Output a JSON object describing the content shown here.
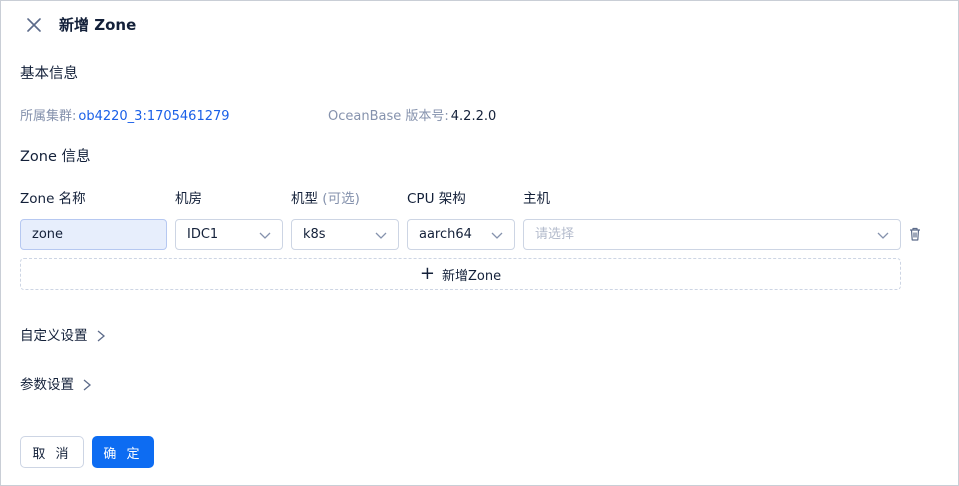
{
  "header": {
    "title": "新增 Zone",
    "close_icon": "close-icon"
  },
  "basic_info": {
    "heading": "基本信息",
    "cluster_label": "所属集群:",
    "cluster_value": "ob4220_3:1705461279",
    "version_label": "OceanBase 版本号:",
    "version_value": "4.2.2.0"
  },
  "zone_info": {
    "heading": "Zone 信息",
    "columns": {
      "zone_name": "Zone 名称",
      "idc": "机房",
      "machine_type": "机型",
      "machine_type_optional": "(可选)",
      "cpu_arch": "CPU 架构",
      "host": "主机"
    },
    "row": {
      "zone_name": "zone",
      "idc": "IDC1",
      "machine_type": "k8s",
      "cpu_arch": "aarch64",
      "host_placeholder": "请选择"
    },
    "add_zone_label": "新增Zone"
  },
  "custom_settings": {
    "label": "自定义设置"
  },
  "param_settings": {
    "label": "参数设置"
  },
  "footer": {
    "cancel_label": "取 消",
    "ok_label": "确 定"
  },
  "colors": {
    "primary": "#0d6cf2",
    "link": "#1a60e8",
    "text": "#132039",
    "muted": "#8592ad",
    "border": "#cdd5e4"
  }
}
